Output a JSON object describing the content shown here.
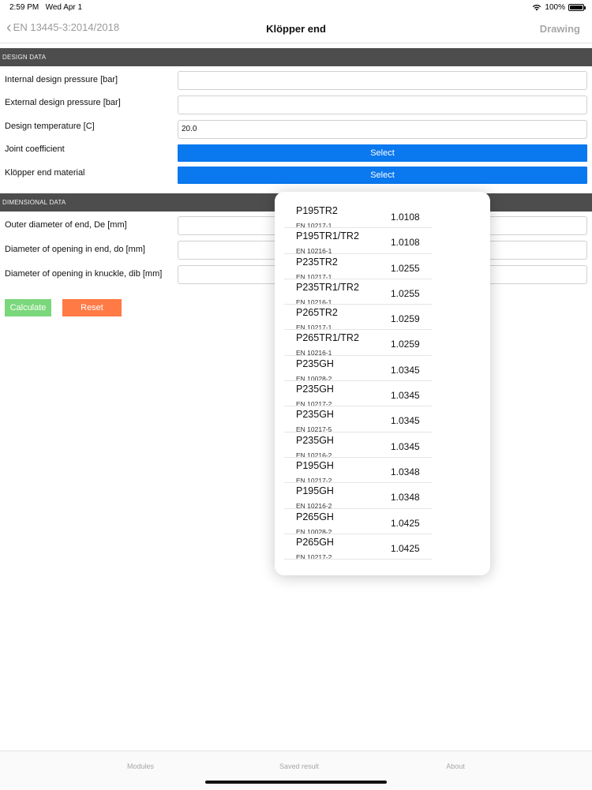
{
  "status": {
    "time": "2:59 PM",
    "date": "Wed Apr 1",
    "battery": "100%"
  },
  "nav": {
    "back_label": "EN 13445-3:2014/2018",
    "title": "Klöpper end",
    "right_label": "Drawing"
  },
  "design": {
    "header": "DESIGN DATA",
    "internal_label": "Internal design pressure [bar]",
    "internal_value": "",
    "external_label": "External design pressure [bar]",
    "external_value": "",
    "temp_label": "Design temperature [C]",
    "temp_value": "20.0",
    "joint_label": "Joint coefficient",
    "joint_button": "Select",
    "material_label": "Klöpper end material",
    "material_button": "Select"
  },
  "dimensional": {
    "header": "DIMENSIONAL DATA",
    "outer_label": "Outer diameter of end, De [mm]",
    "opening_end_label": "Diameter of opening in end, do [mm]",
    "opening_knuckle_label": "Diameter of opening in knuckle, dib [mm]"
  },
  "actions": {
    "calculate": "Calculate",
    "reset": "Reset"
  },
  "materials": [
    {
      "name": "P195TR2",
      "std": "EN 10217-1",
      "num": "1.0108"
    },
    {
      "name": "P195TR1/TR2",
      "std": "EN 10216-1",
      "num": "1.0108"
    },
    {
      "name": "P235TR2",
      "std": "EN 10217-1",
      "num": "1.0255"
    },
    {
      "name": "P235TR1/TR2",
      "std": "EN 10216-1",
      "num": "1.0255"
    },
    {
      "name": "P265TR2",
      "std": "EN 10217-1",
      "num": "1.0259"
    },
    {
      "name": "P265TR1/TR2",
      "std": "EN 10216-1",
      "num": "1.0259"
    },
    {
      "name": "P235GH",
      "std": "EN 10028-2",
      "num": "1.0345"
    },
    {
      "name": "P235GH",
      "std": "EN 10217-2",
      "num": "1.0345"
    },
    {
      "name": "P235GH",
      "std": "EN 10217-5",
      "num": "1.0345"
    },
    {
      "name": "P235GH",
      "std": "EN 10216-2",
      "num": "1.0345"
    },
    {
      "name": "P195GH",
      "std": "EN 10217-2",
      "num": "1.0348"
    },
    {
      "name": "P195GH",
      "std": "EN 10216-2",
      "num": "1.0348"
    },
    {
      "name": "P265GH",
      "std": "EN 10028-2",
      "num": "1.0425"
    },
    {
      "name": "P265GH",
      "std": "EN 10217-2",
      "num": "1.0425"
    }
  ],
  "tabs": {
    "modules": "Modules",
    "saved": "Saved result",
    "about": "About"
  },
  "colors": {
    "accent": "#0a78ee",
    "calculate": "#7bd77b",
    "reset": "#ff7a45",
    "header": "#4d4d4d"
  }
}
